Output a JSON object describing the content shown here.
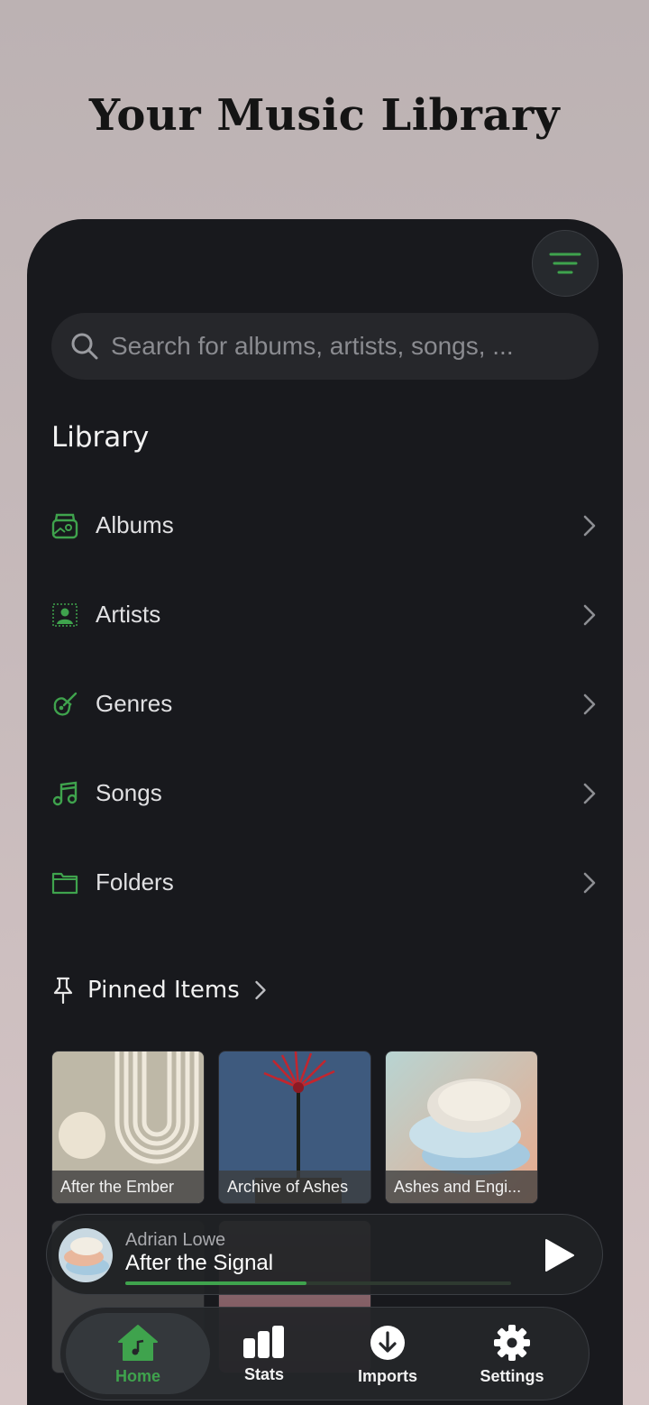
{
  "promo_title": "Your Music Library",
  "search": {
    "placeholder": "Search for albums, artists, songs, ..."
  },
  "library": {
    "title": "Library",
    "items": [
      {
        "label": "Albums",
        "icon": "album-icon"
      },
      {
        "label": "Artists",
        "icon": "artist-icon"
      },
      {
        "label": "Genres",
        "icon": "guitar-icon"
      },
      {
        "label": "Songs",
        "icon": "music-note-icon"
      },
      {
        "label": "Folders",
        "icon": "folder-icon"
      }
    ]
  },
  "pinned": {
    "title": "Pinned Items",
    "items": [
      {
        "label": "After the Ember"
      },
      {
        "label": "Archive of Ashes"
      },
      {
        "label": "Ashes and Engi..."
      }
    ]
  },
  "player": {
    "artist": "Adrian Lowe",
    "song": "After the Signal",
    "progress": 0.47
  },
  "tabs": [
    {
      "label": "Home",
      "icon": "home-icon",
      "active": true
    },
    {
      "label": "Stats",
      "icon": "stats-icon",
      "active": false
    },
    {
      "label": "Imports",
      "icon": "download-icon",
      "active": false
    },
    {
      "label": "Settings",
      "icon": "gear-icon",
      "active": false
    }
  ],
  "colors": {
    "accent": "#3fa34d",
    "background": "#18191d",
    "surface": "#26272b"
  }
}
